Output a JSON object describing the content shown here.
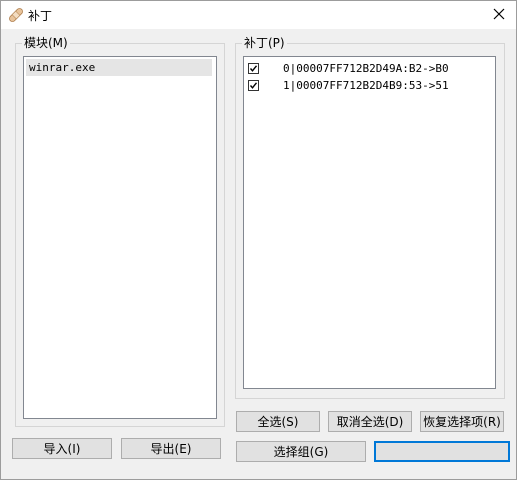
{
  "window": {
    "title": "补丁",
    "title_icon": "bandage-icon",
    "close_icon": "close-icon"
  },
  "modules": {
    "label": "模块(M)",
    "items": [
      "winrar.exe"
    ]
  },
  "patches": {
    "label": "补丁(P)",
    "items": [
      {
        "checked": true,
        "text": "0|00007FF712B2D49A:B2->B0"
      },
      {
        "checked": true,
        "text": "1|00007FF712B2D4B9:53->51"
      }
    ]
  },
  "buttons": {
    "select_all": "全选(S)",
    "deselect_all": "取消全选(D)",
    "restore_selection": "恢复选择项(R)",
    "import": "导入(I)",
    "export": "导出(E)",
    "select_group": "选择组(G)",
    "default_button": ""
  },
  "colors": {
    "accent": "#0078d7",
    "check": "#000000"
  }
}
